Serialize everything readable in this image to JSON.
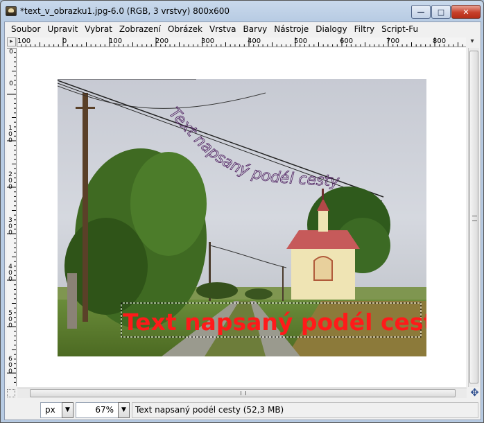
{
  "window": {
    "title": "*text_v_obrazku1.jpg-6.0 (RGB, 3 vrstvy) 800x600",
    "controls": {
      "minimize": "—",
      "maximize": "□",
      "close": "✕"
    }
  },
  "menu": [
    {
      "label": "Soubor"
    },
    {
      "label": "Upravit"
    },
    {
      "label": "Vybrat"
    },
    {
      "label": "Zobrazení"
    },
    {
      "label": "Obrázek"
    },
    {
      "label": "Vrstva"
    },
    {
      "label": "Barvy"
    },
    {
      "label": "Nástroje"
    },
    {
      "label": "Dialogy"
    },
    {
      "label": "Filtry"
    },
    {
      "label": "Script-Fu"
    }
  ],
  "ruler": {
    "horizontal_labels": [
      "100",
      "0",
      "100",
      "200",
      "300",
      "400",
      "500",
      "600",
      "700",
      "800"
    ],
    "vertical_labels": [
      "0",
      "0",
      "1 0 0",
      "2 0 0",
      "3 0 0",
      "4 0 0",
      "5 0 0",
      "6 0 0"
    ]
  },
  "canvas": {
    "text_layer": "Text napsaný podél cesty",
    "path_text": "Text napsaný podél cesty",
    "text_color": "#ff1a1a",
    "path_color": "#4a1a5c"
  },
  "statusbar": {
    "unit": "px",
    "zoom": "67%",
    "message": "Text napsaný podél cesty (52,3 MB)"
  },
  "icons": {
    "quick_mask": "quickmask-icon",
    "navigate": "navigate-icon",
    "ruler_menu": "ruler-menu-icon"
  }
}
